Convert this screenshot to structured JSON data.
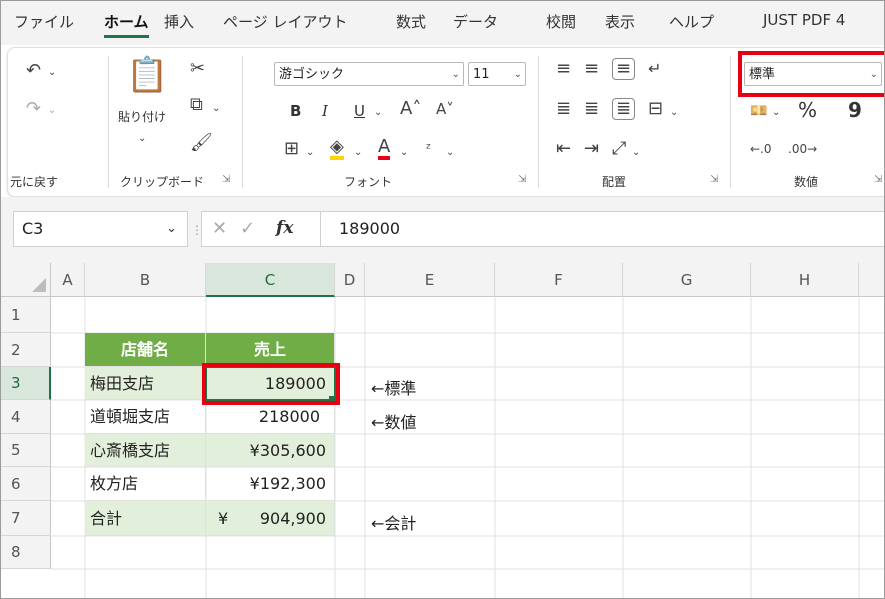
{
  "ribbon_tabs": [
    "ファイル",
    "ホーム",
    "挿入",
    "ページ レイアウト",
    "数式",
    "データ",
    "校閲",
    "表示",
    "ヘルプ",
    "JUST PDF 4"
  ],
  "active_tab": "ホーム",
  "clipboard": {
    "paste_label": "貼り付け",
    "group_label": "クリップボード"
  },
  "undo": {
    "group_label": "元に戻す"
  },
  "font": {
    "name": "游ゴシック",
    "size": "11",
    "bold": "B",
    "italic": "I",
    "underline": "U",
    "group_label": "フォント"
  },
  "alignment": {
    "group_label": "配置"
  },
  "number": {
    "format": "標準",
    "percent": "%",
    "comma": "9",
    "group_label": "数値"
  },
  "formula_bar": {
    "name_box": "C3",
    "fx": "fx",
    "value": "189000"
  },
  "columns": [
    "A",
    "B",
    "C",
    "D",
    "E",
    "F",
    "G",
    "H"
  ],
  "rows": [
    "1",
    "2",
    "3",
    "4",
    "5",
    "6",
    "7",
    "8"
  ],
  "table": {
    "headers": [
      "店舗名",
      "売上"
    ],
    "rows": [
      {
        "store": "梅田支店",
        "sales": "189000"
      },
      {
        "store": "道頓堀支店",
        "sales": "218000"
      },
      {
        "store": "心斎橋支店",
        "sales": "¥305,600"
      },
      {
        "store": "枚方店",
        "sales": "¥192,300"
      },
      {
        "store": "合計",
        "sales_yen": "¥",
        "sales": "904,900"
      }
    ]
  },
  "notes": [
    "←標準",
    "←数値",
    "←会計"
  ],
  "colors": {
    "accent_green": "#217346",
    "table_header": "#70ad47",
    "table_band": "#e2efda",
    "highlight_red": "#e60012"
  }
}
